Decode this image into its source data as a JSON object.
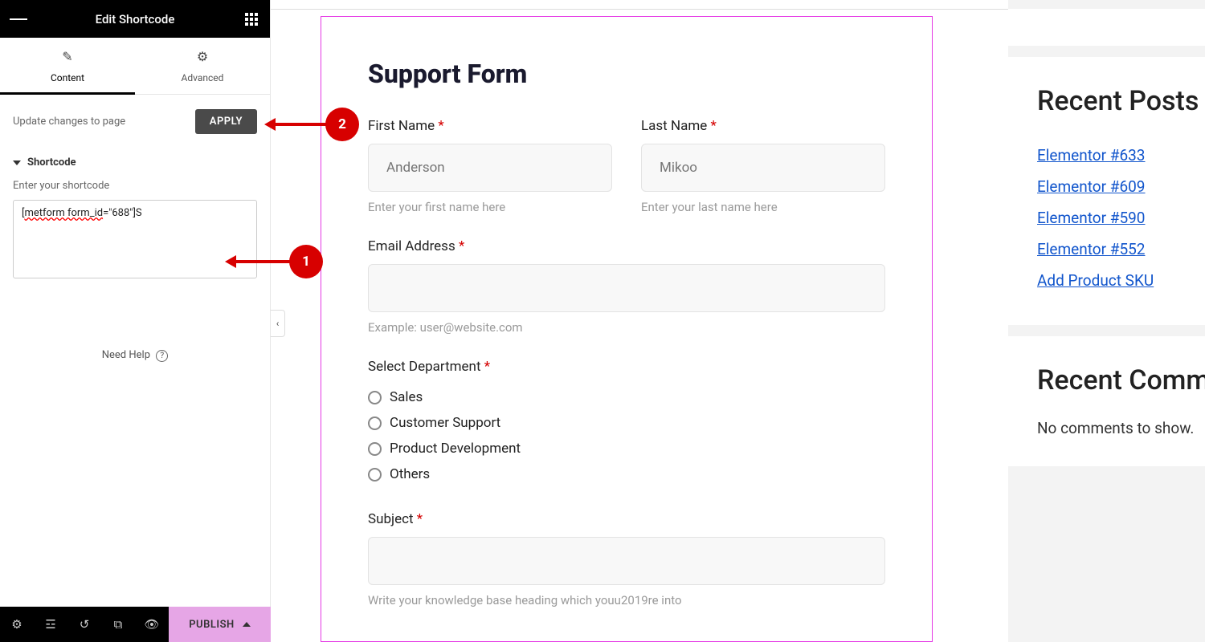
{
  "panel": {
    "title": "Edit Shortcode",
    "tabs": {
      "content": "Content",
      "advanced": "Advanced"
    },
    "apply_msg": "Update changes to page",
    "apply_btn": "APPLY",
    "section_title": "Shortcode",
    "shortcode_label": "Enter your shortcode",
    "shortcode_value_pre": "[",
    "shortcode_value_u": "metform form_id",
    "shortcode_value_post": "=\"688\"]S",
    "need_help": "Need Help",
    "publish": "PUBLISH"
  },
  "form": {
    "title": "Support Form",
    "first_name": {
      "label": "First Name",
      "placeholder": "Anderson",
      "hint": "Enter your first name here"
    },
    "last_name": {
      "label": "Last Name",
      "placeholder": "Mikoo",
      "hint": "Enter your last name here"
    },
    "email": {
      "label": "Email Address",
      "hint": "Example: user@website.com"
    },
    "dept": {
      "label": "Select Department",
      "options": [
        "Sales",
        "Customer Support",
        "Product Development",
        "Others"
      ]
    },
    "subject": {
      "label": "Subject",
      "hint": "Write your knowledge base heading which youu2019re into"
    }
  },
  "sidebar": {
    "recent_posts_title": "Recent Posts",
    "posts": [
      "Elementor #633",
      "Elementor #609",
      "Elementor #590",
      "Elementor #552",
      "Add Product SKU"
    ],
    "recent_comments_title": "Recent Comments",
    "no_comments": "No comments to show."
  },
  "anno": {
    "one": "1",
    "two": "2"
  }
}
